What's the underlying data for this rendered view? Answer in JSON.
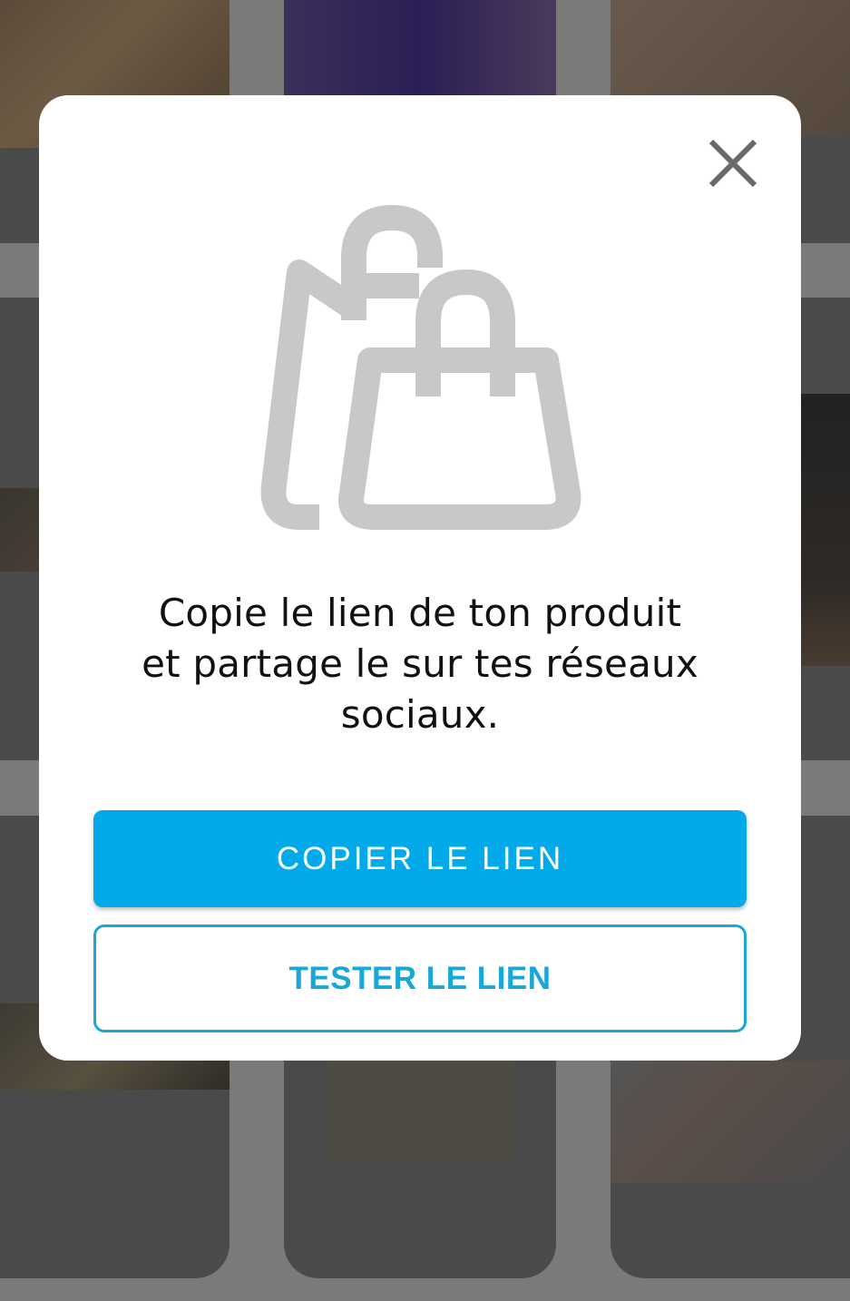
{
  "modal": {
    "message": "Copie le lien de ton produit et partage le sur tes réseaux sociaux.",
    "message_lines": [
      "Copie le lien de ton produit",
      "et partage le sur tes réseaux",
      "sociaux."
    ],
    "copy_button_label": "COPIER LE LIEN",
    "test_button_label": "TESTER LE LIEN",
    "close_icon": "close-icon",
    "illustration_icon": "shopping-bags-icon"
  },
  "colors": {
    "primary": "#03aaea",
    "secondary_border": "#1aa6d6",
    "icon_gray": "#c8c8c8",
    "overlay_card": "#4a4a4a"
  }
}
